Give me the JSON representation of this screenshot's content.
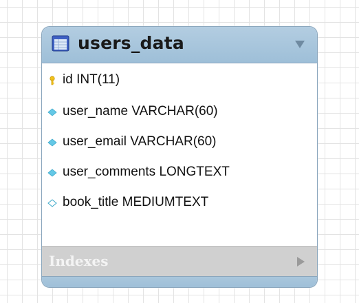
{
  "table": {
    "name": "users_data",
    "icon": "table-icon",
    "columns": [
      {
        "text": "id INT(11)",
        "icon": "primary-key-icon"
      },
      {
        "text": "user_name VARCHAR(60)",
        "icon": "column-filled-diamond-icon"
      },
      {
        "text": "user_email VARCHAR(60)",
        "icon": "column-filled-diamond-icon"
      },
      {
        "text": "user_comments LONGTEXT",
        "icon": "column-filled-diamond-icon"
      },
      {
        "text": "book_title MEDIUMTEXT",
        "icon": "column-empty-diamond-icon"
      }
    ],
    "indexes_label": "Indexes"
  },
  "colors": {
    "header": "#9ebfd8",
    "indexes_bar": "#d0d0d0",
    "key": "#f2c21b",
    "column_diamond": "#64c8e6"
  }
}
